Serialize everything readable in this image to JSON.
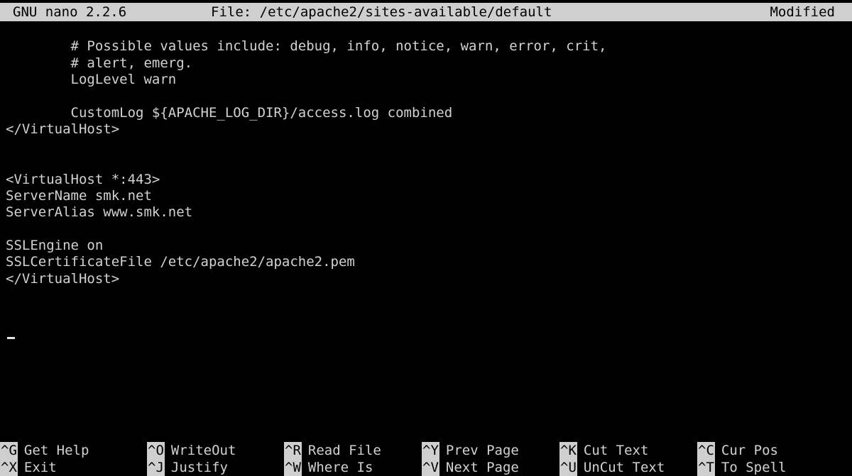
{
  "titlebar": {
    "app": "GNU nano 2.2.6",
    "file": "File: /etc/apache2/sites-available/default",
    "status": "Modified"
  },
  "editor": {
    "lines": [
      "",
      "        # Possible values include: debug, info, notice, warn, error, crit,",
      "        # alert, emerg.",
      "        LogLevel warn",
      "",
      "        CustomLog ${APACHE_LOG_DIR}/access.log combined",
      "</VirtualHost>",
      "",
      "",
      "<VirtualHost *:443>",
      "ServerName smk.net",
      "ServerAlias www.smk.net",
      "",
      "SSLEngine on",
      "SSLCertificateFile /etc/apache2/apache2.pem",
      "</VirtualHost>",
      "",
      "",
      "",
      "",
      "",
      "",
      "",
      ""
    ]
  },
  "shortcuts": {
    "row1": [
      {
        "key": "^G",
        "label": "Get Help"
      },
      {
        "key": "^O",
        "label": "WriteOut"
      },
      {
        "key": "^R",
        "label": "Read File"
      },
      {
        "key": "^Y",
        "label": "Prev Page"
      },
      {
        "key": "^K",
        "label": "Cut Text"
      },
      {
        "key": "^C",
        "label": "Cur Pos"
      }
    ],
    "row2": [
      {
        "key": "^X",
        "label": "Exit"
      },
      {
        "key": "^J",
        "label": "Justify"
      },
      {
        "key": "^W",
        "label": "Where Is"
      },
      {
        "key": "^V",
        "label": "Next Page"
      },
      {
        "key": "^U",
        "label": "UnCut Text"
      },
      {
        "key": "^T",
        "label": "To Spell"
      }
    ]
  }
}
